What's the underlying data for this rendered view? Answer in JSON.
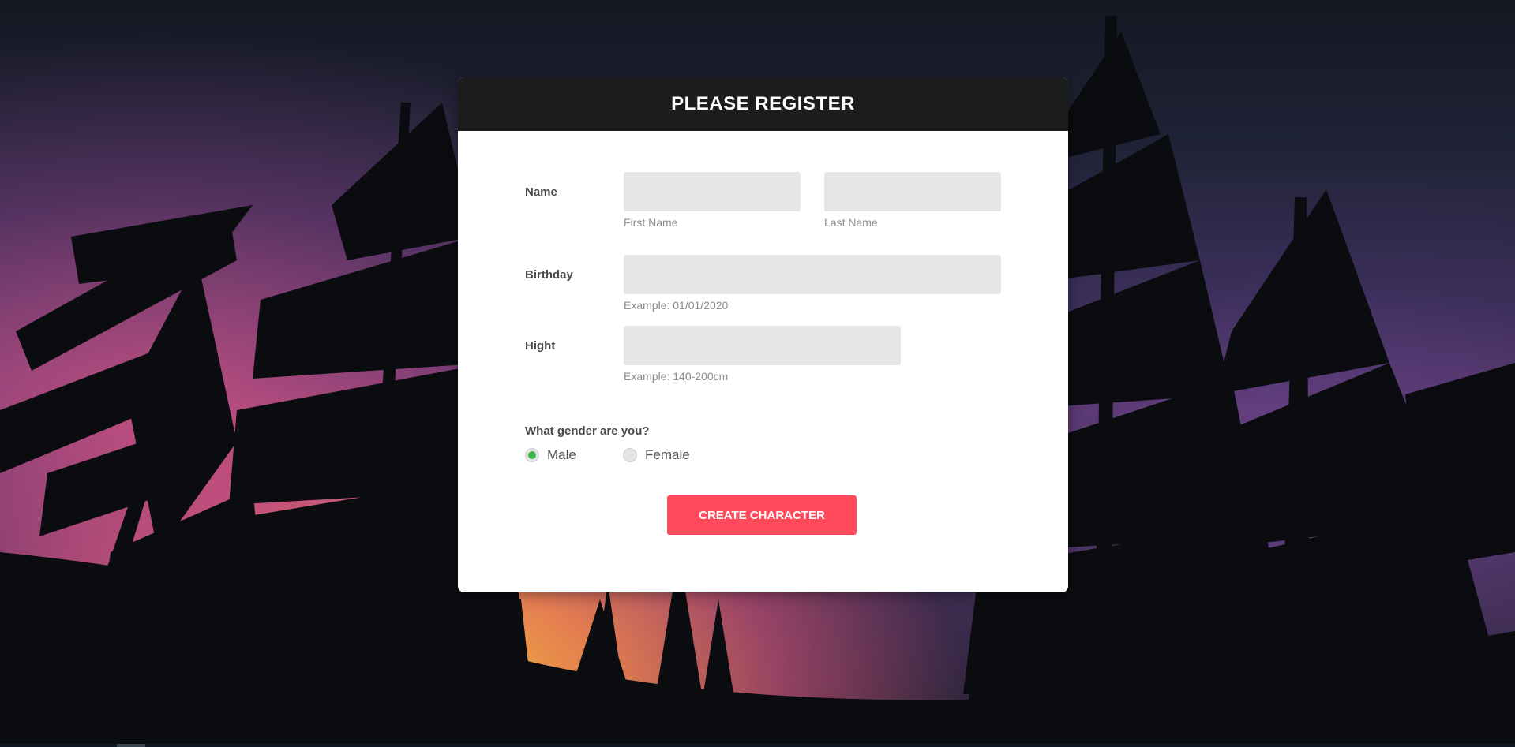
{
  "form": {
    "title": "PLEASE REGISTER",
    "name": {
      "label": "Name",
      "first_hint": "First Name",
      "last_hint": "Last Name",
      "first_value": "",
      "last_value": ""
    },
    "birthday": {
      "label": "Birthday",
      "hint": "Example: 01/01/2020",
      "value": ""
    },
    "height": {
      "label": "Hight",
      "hint": "Example: 140-200cm",
      "value": ""
    },
    "gender": {
      "question": "What gender are you?",
      "options": [
        {
          "label": "Male",
          "selected": true
        },
        {
          "label": "Female",
          "selected": false
        }
      ]
    },
    "submit_label": "CREATE CHARACTER"
  },
  "colors": {
    "header_bg": "#1c1c1c",
    "input_bg": "#e6e6e6",
    "button_bg": "#ff4a5c",
    "radio_selected": "#3bb54a"
  }
}
